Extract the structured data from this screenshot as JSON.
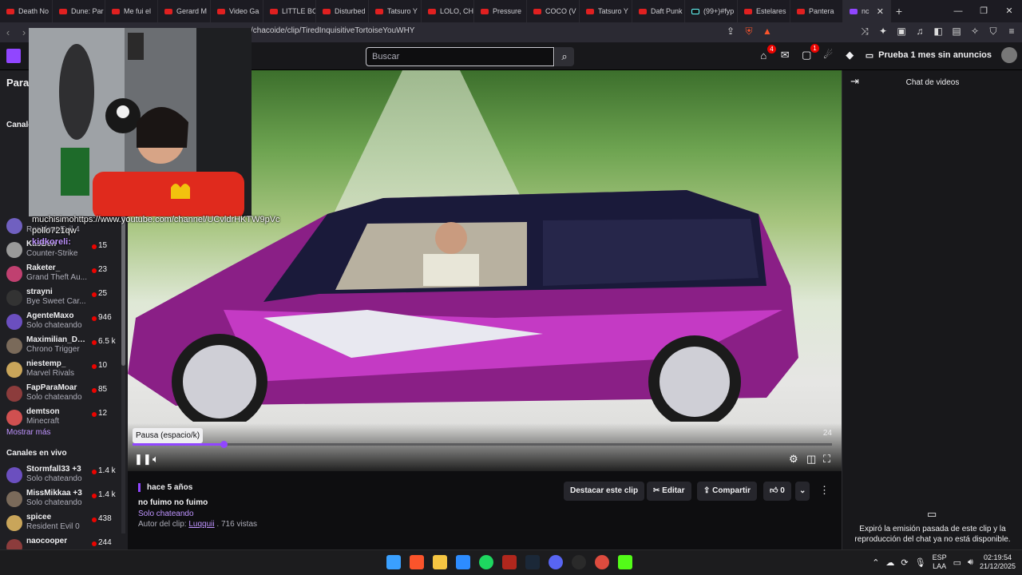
{
  "browser": {
    "tabs": [
      {
        "label": "Death No"
      },
      {
        "label": "Dune: Par"
      },
      {
        "label": "Me fui el"
      },
      {
        "label": "Gerard M"
      },
      {
        "label": "Video Ga"
      },
      {
        "label": "LITTLE BO"
      },
      {
        "label": "Disturbed"
      },
      {
        "label": "Tatsuro Y"
      },
      {
        "label": "LOLO, CH"
      },
      {
        "label": "Pressure"
      },
      {
        "label": "COCO (V"
      },
      {
        "label": "Tatsuro Y"
      },
      {
        "label": "Daft Punk"
      },
      {
        "label": "(99+)#fyp"
      },
      {
        "label": "Estelares"
      },
      {
        "label": "Pantera"
      },
      {
        "label": "nc"
      }
    ],
    "url": "/chacoide/clip/TiredInquisitiveTortoiseYouWHY"
  },
  "twitch_header": {
    "search_placeholder": "Buscar",
    "inbox_badge": "4",
    "whispers_badge": "1",
    "prime_label": "Prueba 1 mes sin anuncios"
  },
  "sidebar": {
    "heading": "Para t",
    "section_followed": "Canale",
    "channels_top": [
      {
        "name": "",
        "game": "Resident Evil 4",
        "viewers": ""
      },
      {
        "name": "KasBen",
        "game": "Counter-Strike",
        "viewers": "15"
      },
      {
        "name": "Raketer_",
        "game": "Grand Theft Au...",
        "viewers": "23"
      },
      {
        "name": "strayni",
        "game": "Bye Sweet Car...",
        "viewers": "25"
      },
      {
        "name": "AgenteMaxo",
        "game": "Solo chateando",
        "viewers": "946"
      },
      {
        "name": "Maximilian_DO...",
        "game": "Chrono Trigger",
        "viewers": "6.5 k"
      },
      {
        "name": "niestemp_",
        "game": "Marvel Rivals",
        "viewers": "10"
      },
      {
        "name": "FapParaMoar",
        "game": "Solo chateando",
        "viewers": "85"
      },
      {
        "name": "demtson",
        "game": "Minecraft",
        "viewers": "12"
      }
    ],
    "show_more": "Mostrar más",
    "section_live": "Canales en vivo",
    "channels_live": [
      {
        "name": "Stormfall33 +3",
        "game": "Solo chateando",
        "viewers": "1.4 k"
      },
      {
        "name": "MissMikkaa +3",
        "game": "Solo chateando",
        "viewers": "1.4 k"
      },
      {
        "name": "spicee",
        "game": "Resident Evil 0",
        "viewers": "438"
      },
      {
        "name": "naocooper",
        "game": "",
        "viewers": "244"
      }
    ]
  },
  "player": {
    "tooltip": "Pausa (espacio/k)",
    "time_right": "24",
    "progress": 0.13
  },
  "webcam_overlay": {
    "chat_line1": "muchisimohttps://www.youtube.com/channel/UCvldrHKTW9pVc",
    "chat_line2": "pollo721qw",
    "chat_user": "kidkoreli:"
  },
  "clip_info": {
    "ago": "hace 5 años",
    "title": "no fuimo no fuimo",
    "category": "Solo chateando",
    "author_prefix": "Autor del clip:",
    "author": "Luqquii",
    "views": ". 716 vistas",
    "feature_btn": "Destacar este clip",
    "edit_btn": "Editar",
    "share_btn": "Compartir",
    "likes": "0"
  },
  "chat_panel": {
    "title": "Chat de videos",
    "expired_msg": "Expiró la emisión pasada de este clip y la reproducción del chat ya no está disponible."
  },
  "taskbar": {
    "lang_top": "ESP",
    "lang_bottom": "LAA",
    "time": "02:19:54",
    "date": "21/12/2025"
  }
}
